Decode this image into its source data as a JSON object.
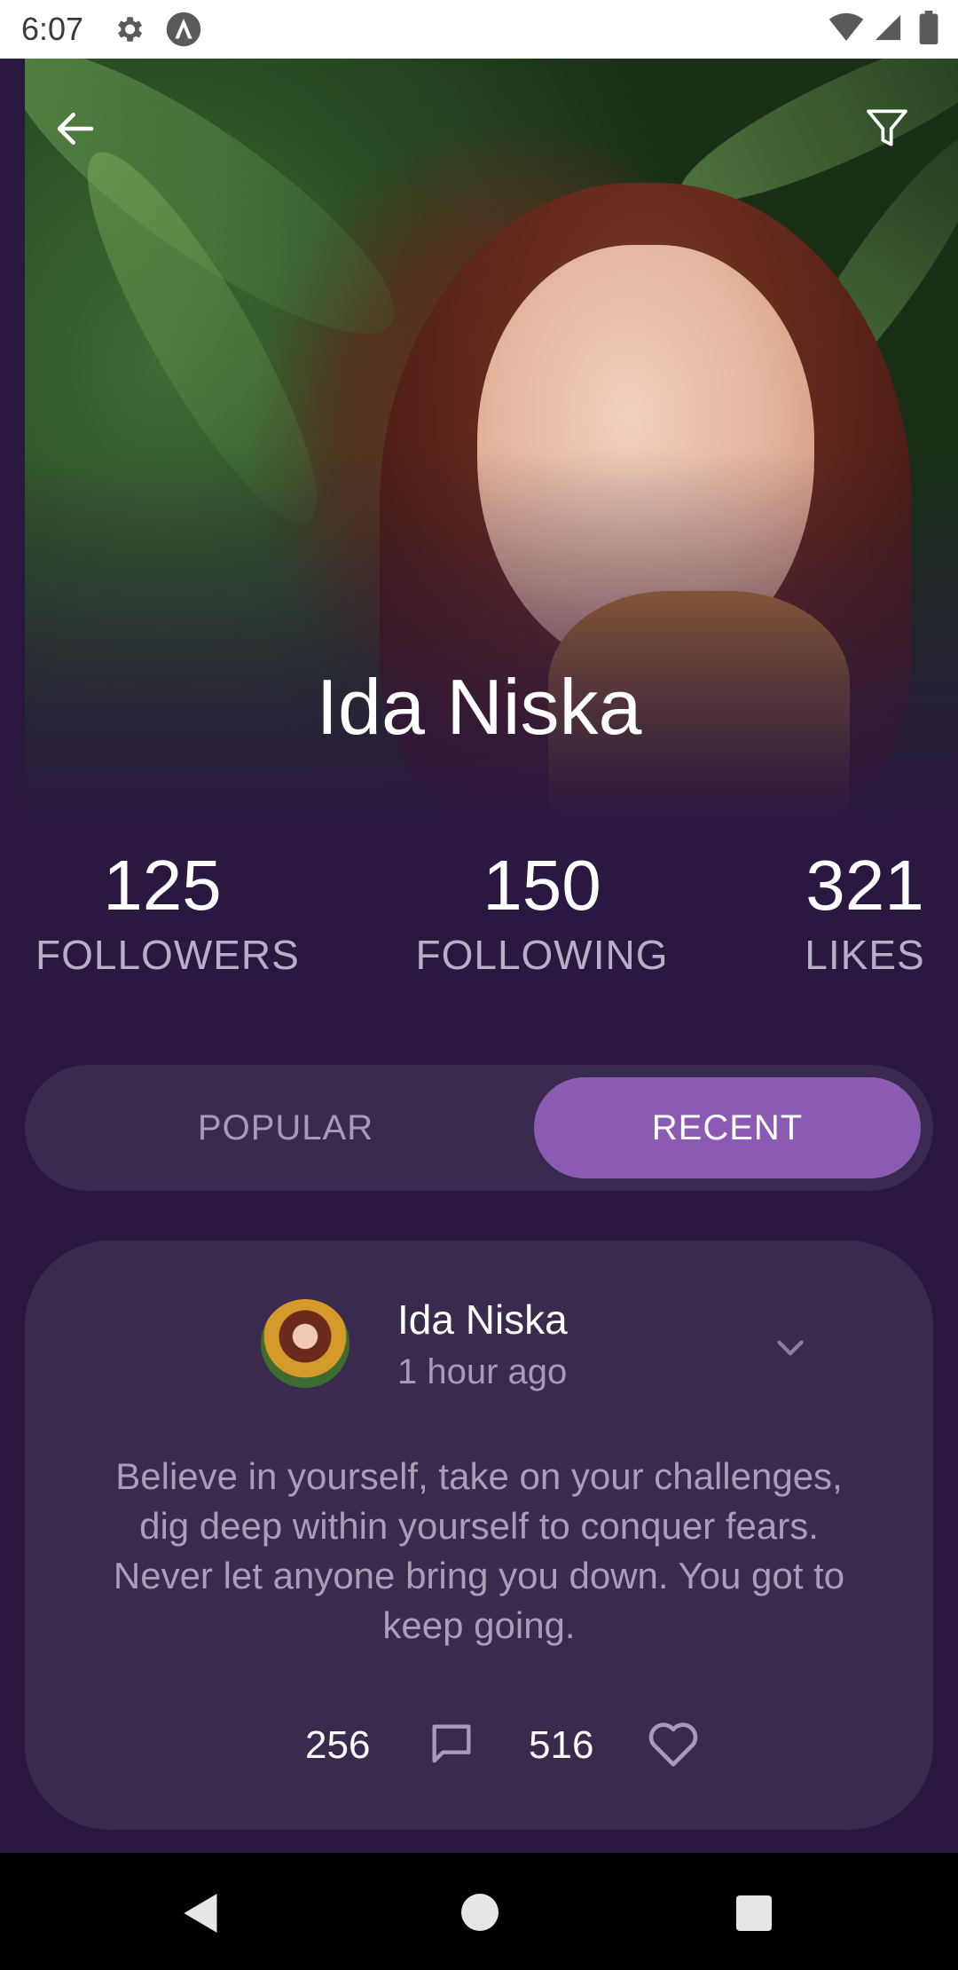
{
  "status_bar": {
    "time": "6:07",
    "icons": [
      "gear-icon",
      "a-icon",
      "wifi-icon",
      "signal-icon",
      "battery-icon"
    ]
  },
  "hero": {
    "name": "Ida Niska",
    "toolbar_icons": [
      "back-arrow-icon",
      "filter-icon"
    ]
  },
  "stats": [
    {
      "value": "125",
      "label": "FOLLOWERS"
    },
    {
      "value": "150",
      "label": "FOLLOWING"
    },
    {
      "value": "321",
      "label": "LIKES"
    }
  ],
  "tabs": {
    "popular": "POPULAR",
    "recent": "RECENT",
    "selected": "RECENT"
  },
  "post": {
    "author": "Ida Niska",
    "time": "1 hour ago",
    "body": "Believe in yourself, take on your challenges, dig deep within yourself to conquer fears. Never let anyone bring you down. You got to keep going.",
    "comments": "256",
    "likes": "516",
    "icons": [
      "chevron-down-icon",
      "comment-icon",
      "heart-icon"
    ]
  },
  "colors": {
    "background": "#2a1840",
    "card": "#392a4e",
    "accent": "#8b5bb4",
    "muted_text": "#a79bb7"
  }
}
